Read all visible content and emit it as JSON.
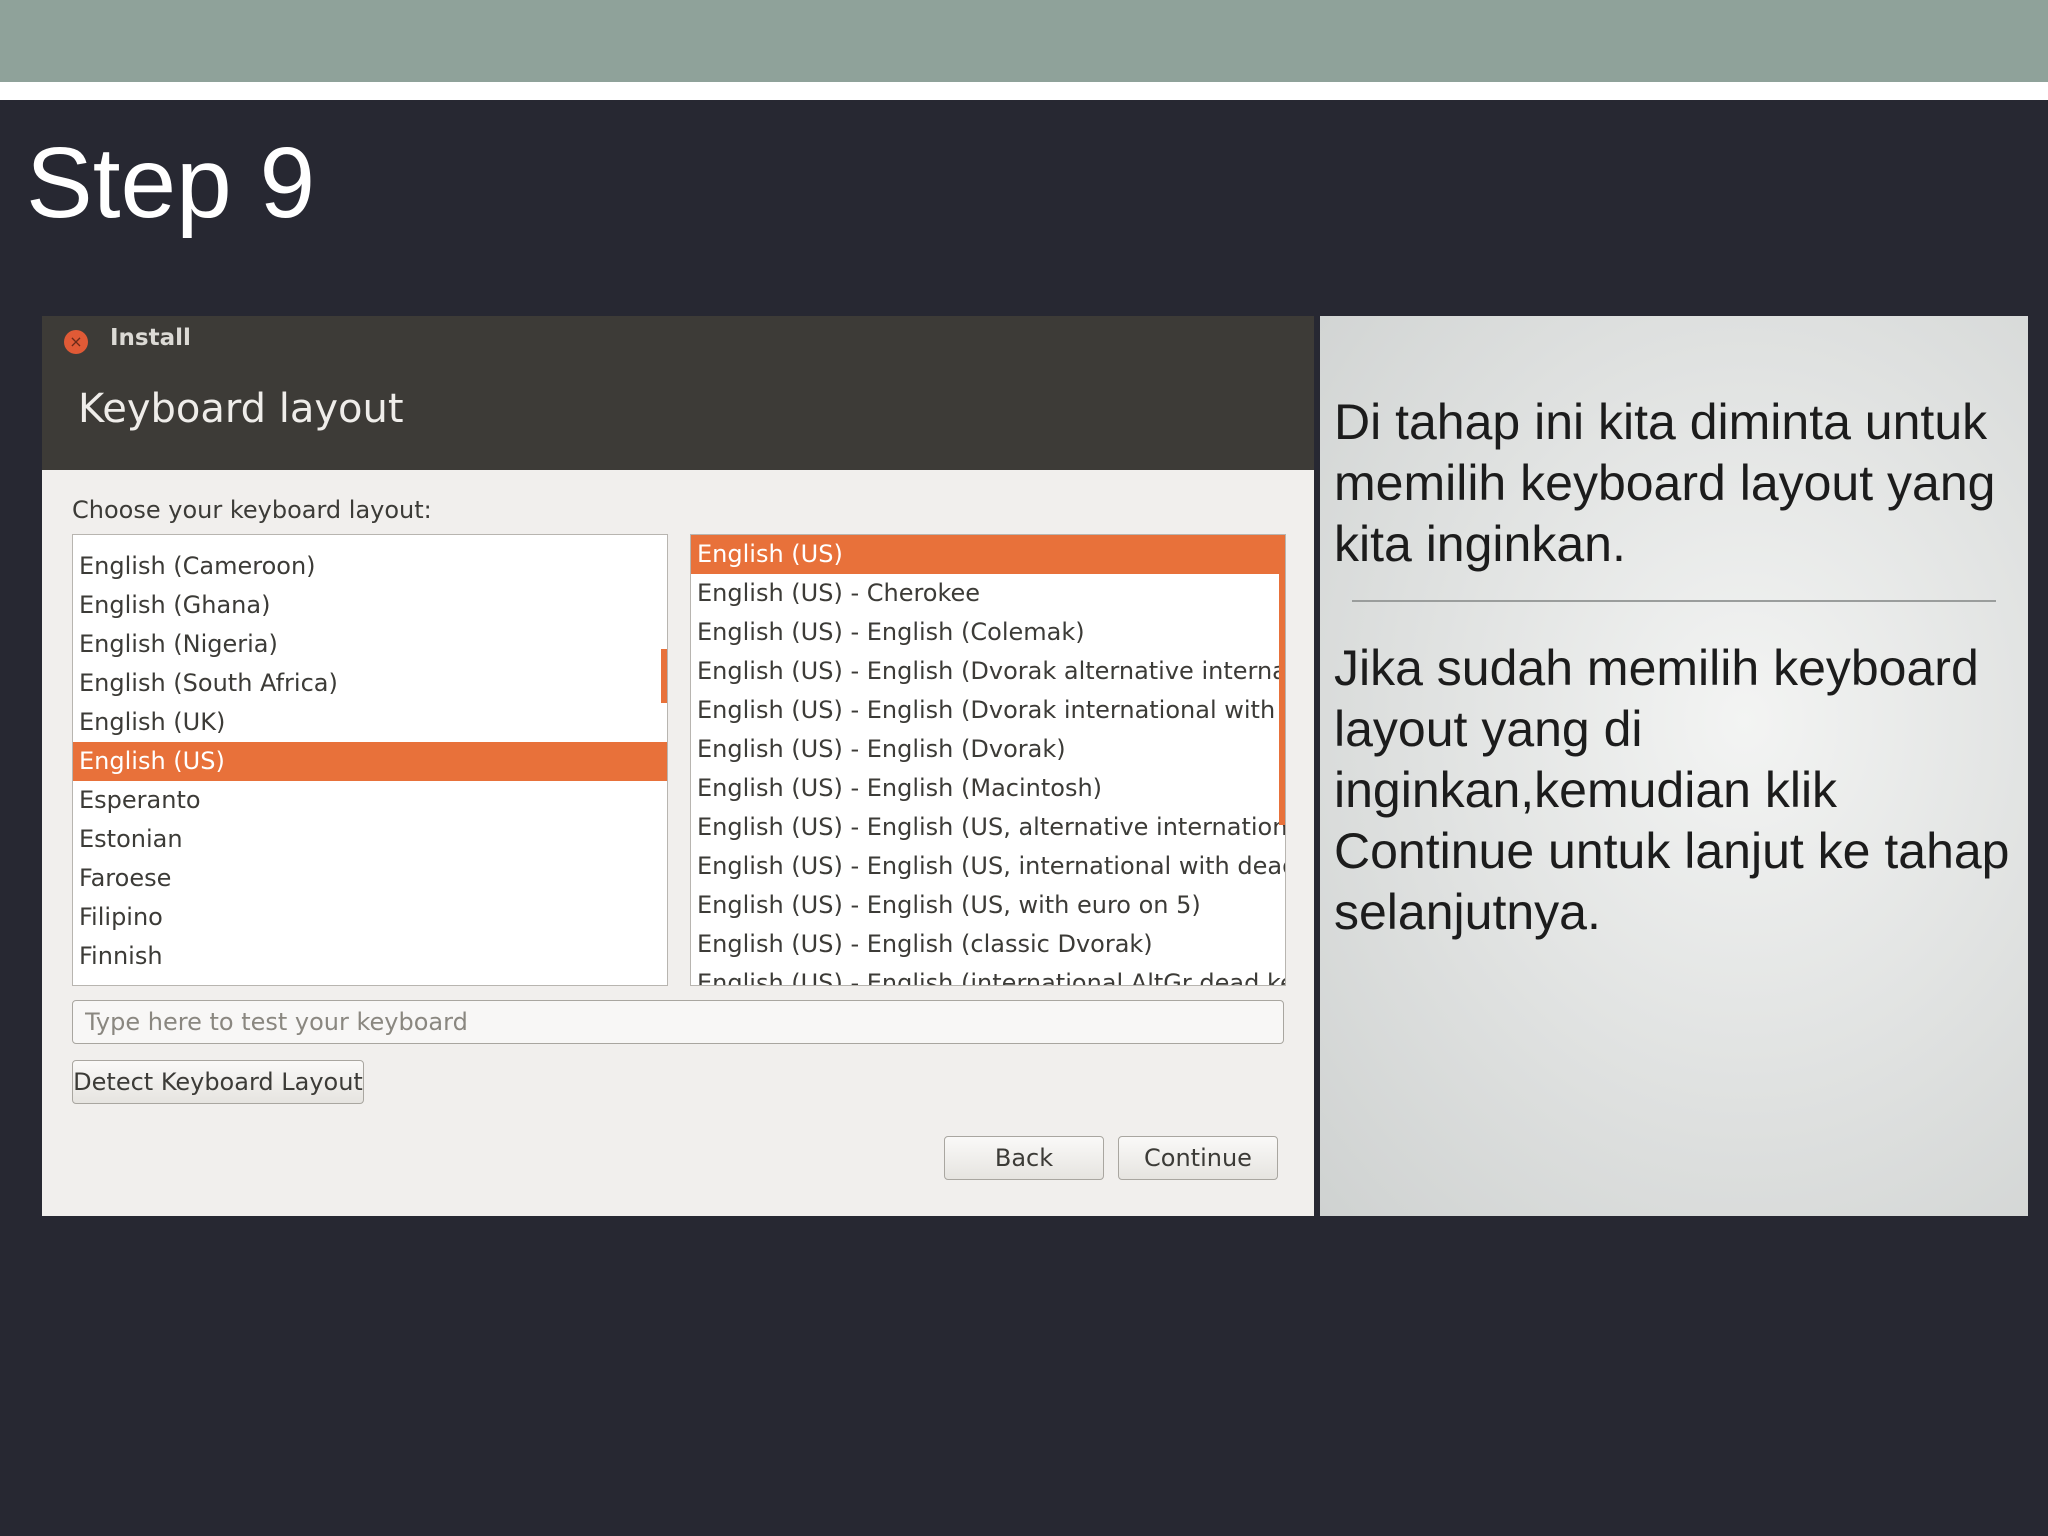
{
  "slide": {
    "title": "Step 9",
    "description_1": "Di tahap ini kita diminta untuk memilih keyboard layout yang kita inginkan.",
    "description_2": "Jika sudah memilih keyboard layout yang di inginkan,kemudian klik Continue untuk lanjut ke tahap selanjutnya."
  },
  "window": {
    "title": "Install",
    "heading": "Keyboard layout",
    "choose_label": "Choose your keyboard layout:",
    "layouts": [
      "English (Cameroon)",
      "English (Ghana)",
      "English (Nigeria)",
      "English (South Africa)",
      "English (UK)",
      "English (US)",
      "Esperanto",
      "Estonian",
      "Faroese",
      "Filipino",
      "Finnish"
    ],
    "selected_layout": "English (US)",
    "variants": [
      "English (US)",
      "English (US) - Cherokee",
      "English (US) - English (Colemak)",
      "English (US) - English (Dvorak alternative international",
      "English (US) - English (Dvorak international with dead",
      "English (US) - English (Dvorak)",
      "English (US) - English (Macintosh)",
      "English (US) - English (US, alternative international)",
      "English (US) - English (US, international with dead key",
      "English (US) - English (US, with euro on 5)",
      "English (US) - English (classic Dvorak)",
      "English (US) - English (international AltGr dead keys)"
    ],
    "selected_variant": "English (US)",
    "test_placeholder": "Type here to test your keyboard",
    "detect_button": "Detect Keyboard Layout",
    "back_button": "Back",
    "continue_button": "Continue"
  },
  "colors": {
    "selection": "#e8713a",
    "header": "#3d3b37",
    "slide_background": "#272832",
    "top_band": "#8fa29a"
  },
  "icons": {
    "close": "close-icon"
  }
}
